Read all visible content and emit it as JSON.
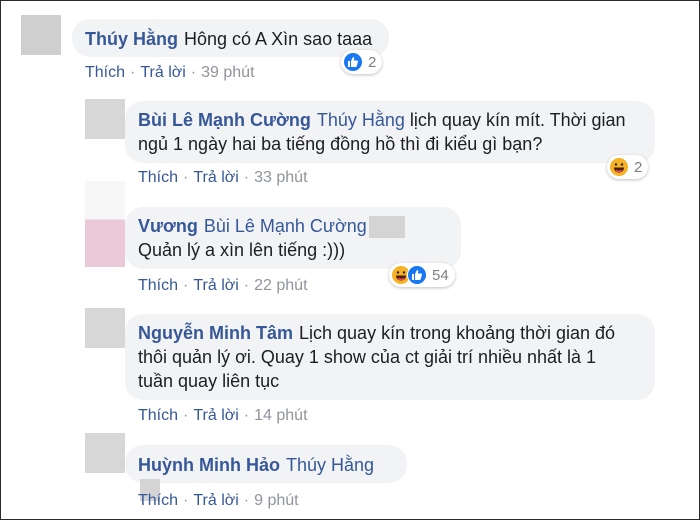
{
  "actions": {
    "like_label": "Thích",
    "reply_label": "Trả lời",
    "separator": "·"
  },
  "comments": [
    {
      "author": "Thúy Hằng",
      "text": "Hông có A Xìn sao taaa",
      "time": "39 phút",
      "reaction_icons": [
        "like-icon"
      ],
      "reaction_count": "2"
    },
    {
      "author": "Bùi Lê Mạnh Cường",
      "mention": "Thúy Hằng",
      "text_line1": "lịch quay kín mít. Thời gian",
      "text_line2": "ngủ 1 ngày hai ba tiếng đồng hồ thì đi kiểu gì bạn?",
      "time": "33 phút",
      "reaction_icons": [
        "haha-icon"
      ],
      "reaction_count": "2"
    },
    {
      "author": "Vương",
      "mention": "Bùi Lê Mạnh Cường",
      "text": "Quản lý a xìn lên tiếng :)))",
      "time": "22 phút",
      "reaction_icons": [
        "haha-icon",
        "like-icon"
      ],
      "reaction_count": "54"
    },
    {
      "author": "Nguyễn Minh Tâm",
      "text_line1": "Lịch quay kín trong khoảng thời gian đó",
      "text_line2": "thôi quản lý ơi. Quay 1 show của ct giải trí nhiều nhất là 1",
      "text_line3": "tuần quay liên tục",
      "time": "14 phút"
    },
    {
      "author": "Huỳnh Minh Hảo",
      "mention": "Thúy Hằng",
      "time": "9 phút"
    }
  ],
  "colors": {
    "name_blue": "#365899",
    "bubble_bg": "#f2f3f5",
    "like_blue": "#1877f2",
    "haha_yellow": "#f7b125"
  }
}
